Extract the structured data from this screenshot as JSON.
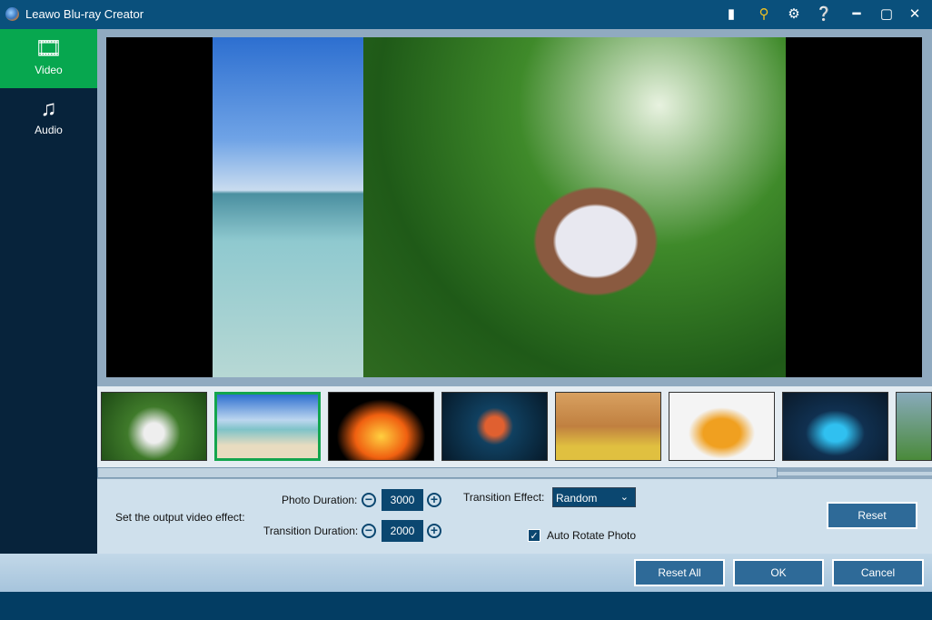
{
  "window": {
    "title": "Leawo Blu-ray Creator",
    "icons": [
      "feedback-icon",
      "key-icon",
      "gear-icon",
      "help-icon",
      "minimize-icon",
      "maximize-icon",
      "close-icon"
    ],
    "accent": "#0a507c"
  },
  "sidebar": {
    "items": [
      {
        "label": "Video",
        "icon": "film-icon",
        "active": true,
        "color": "#07a74f"
      },
      {
        "label": "Audio",
        "icon": "music-note-icon",
        "active": false
      }
    ]
  },
  "thumbnails": [
    "girl-in-forest",
    "beach",
    "fire",
    "neon-heart",
    "black-horse",
    "orange-sports-car",
    "blue-sports-car",
    "green-landscape"
  ],
  "selected_thumbnail": 1,
  "controls": {
    "effect_label": "Set the output video effect:",
    "photo_duration_label": "Photo Duration:",
    "photo_duration": "3000",
    "transition_duration_label": "Transition Duration:",
    "transition_duration": "2000",
    "transition_effect_label": "Transition Effect:",
    "transition_effect": "Random",
    "auto_rotate_label": "Auto Rotate Photo",
    "auto_rotate": true,
    "reset": "Reset"
  },
  "buttons": {
    "reset_all": "Reset All",
    "ok": "OK",
    "cancel": "Cancel"
  }
}
